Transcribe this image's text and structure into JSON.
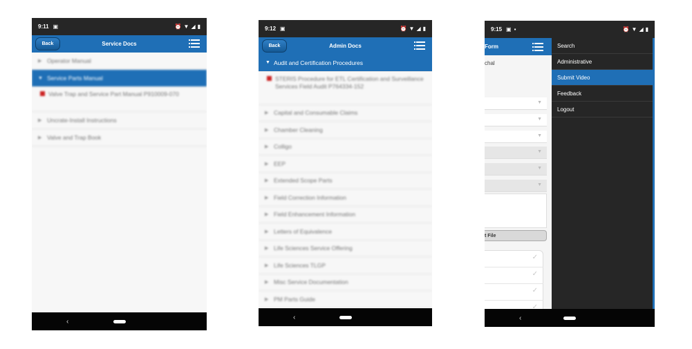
{
  "phones": [
    {
      "time": "9:11",
      "back_label": "Back",
      "title": "Service Docs",
      "items": [
        {
          "label": "Operator Manual"
        },
        {
          "label": "Service Parts Manual"
        },
        {
          "label": "Valve Trap and Service Part Manual P910009-070"
        },
        {
          "label": "Uncrate-Install Instructions"
        },
        {
          "label": "Valve and Trap Book"
        }
      ]
    },
    {
      "time": "9:12",
      "back_label": "Back",
      "title": "Admin Docs",
      "section_header": "Audit and Certification Procedures",
      "items": [
        {
          "label": "STERIS Procedure for ETL Certification and Surveillance Services Field Audit P764334-152"
        },
        {
          "label": "Capital and Consumable Claims"
        },
        {
          "label": "Chamber Cleaning"
        },
        {
          "label": "Colligo"
        },
        {
          "label": "EEP"
        },
        {
          "label": "Extended Scope Parts"
        },
        {
          "label": "Field Correction Information"
        },
        {
          "label": "Field Enhancement Information"
        },
        {
          "label": "Letters of Equivalence"
        },
        {
          "label": "Life Sciences Service Offering"
        },
        {
          "label": "Life Sciences TLGP"
        },
        {
          "label": "Misc Service Documentation"
        },
        {
          "label": "PM Parts Guide"
        }
      ]
    },
    {
      "time": "9:15",
      "form_title": "Form",
      "form_text": "chal",
      "file_button": "t File",
      "menu": [
        {
          "label": "Search"
        },
        {
          "label": "Administrative"
        },
        {
          "label": "Submit Video"
        },
        {
          "label": "Feedback"
        },
        {
          "label": "Logout"
        }
      ]
    }
  ],
  "nav": {
    "back_glyph": "‹"
  },
  "colors": {
    "accent": "#1f6fb6",
    "statusbar": "#262626",
    "drawer": "#262626",
    "pdf": "#cc2222"
  }
}
